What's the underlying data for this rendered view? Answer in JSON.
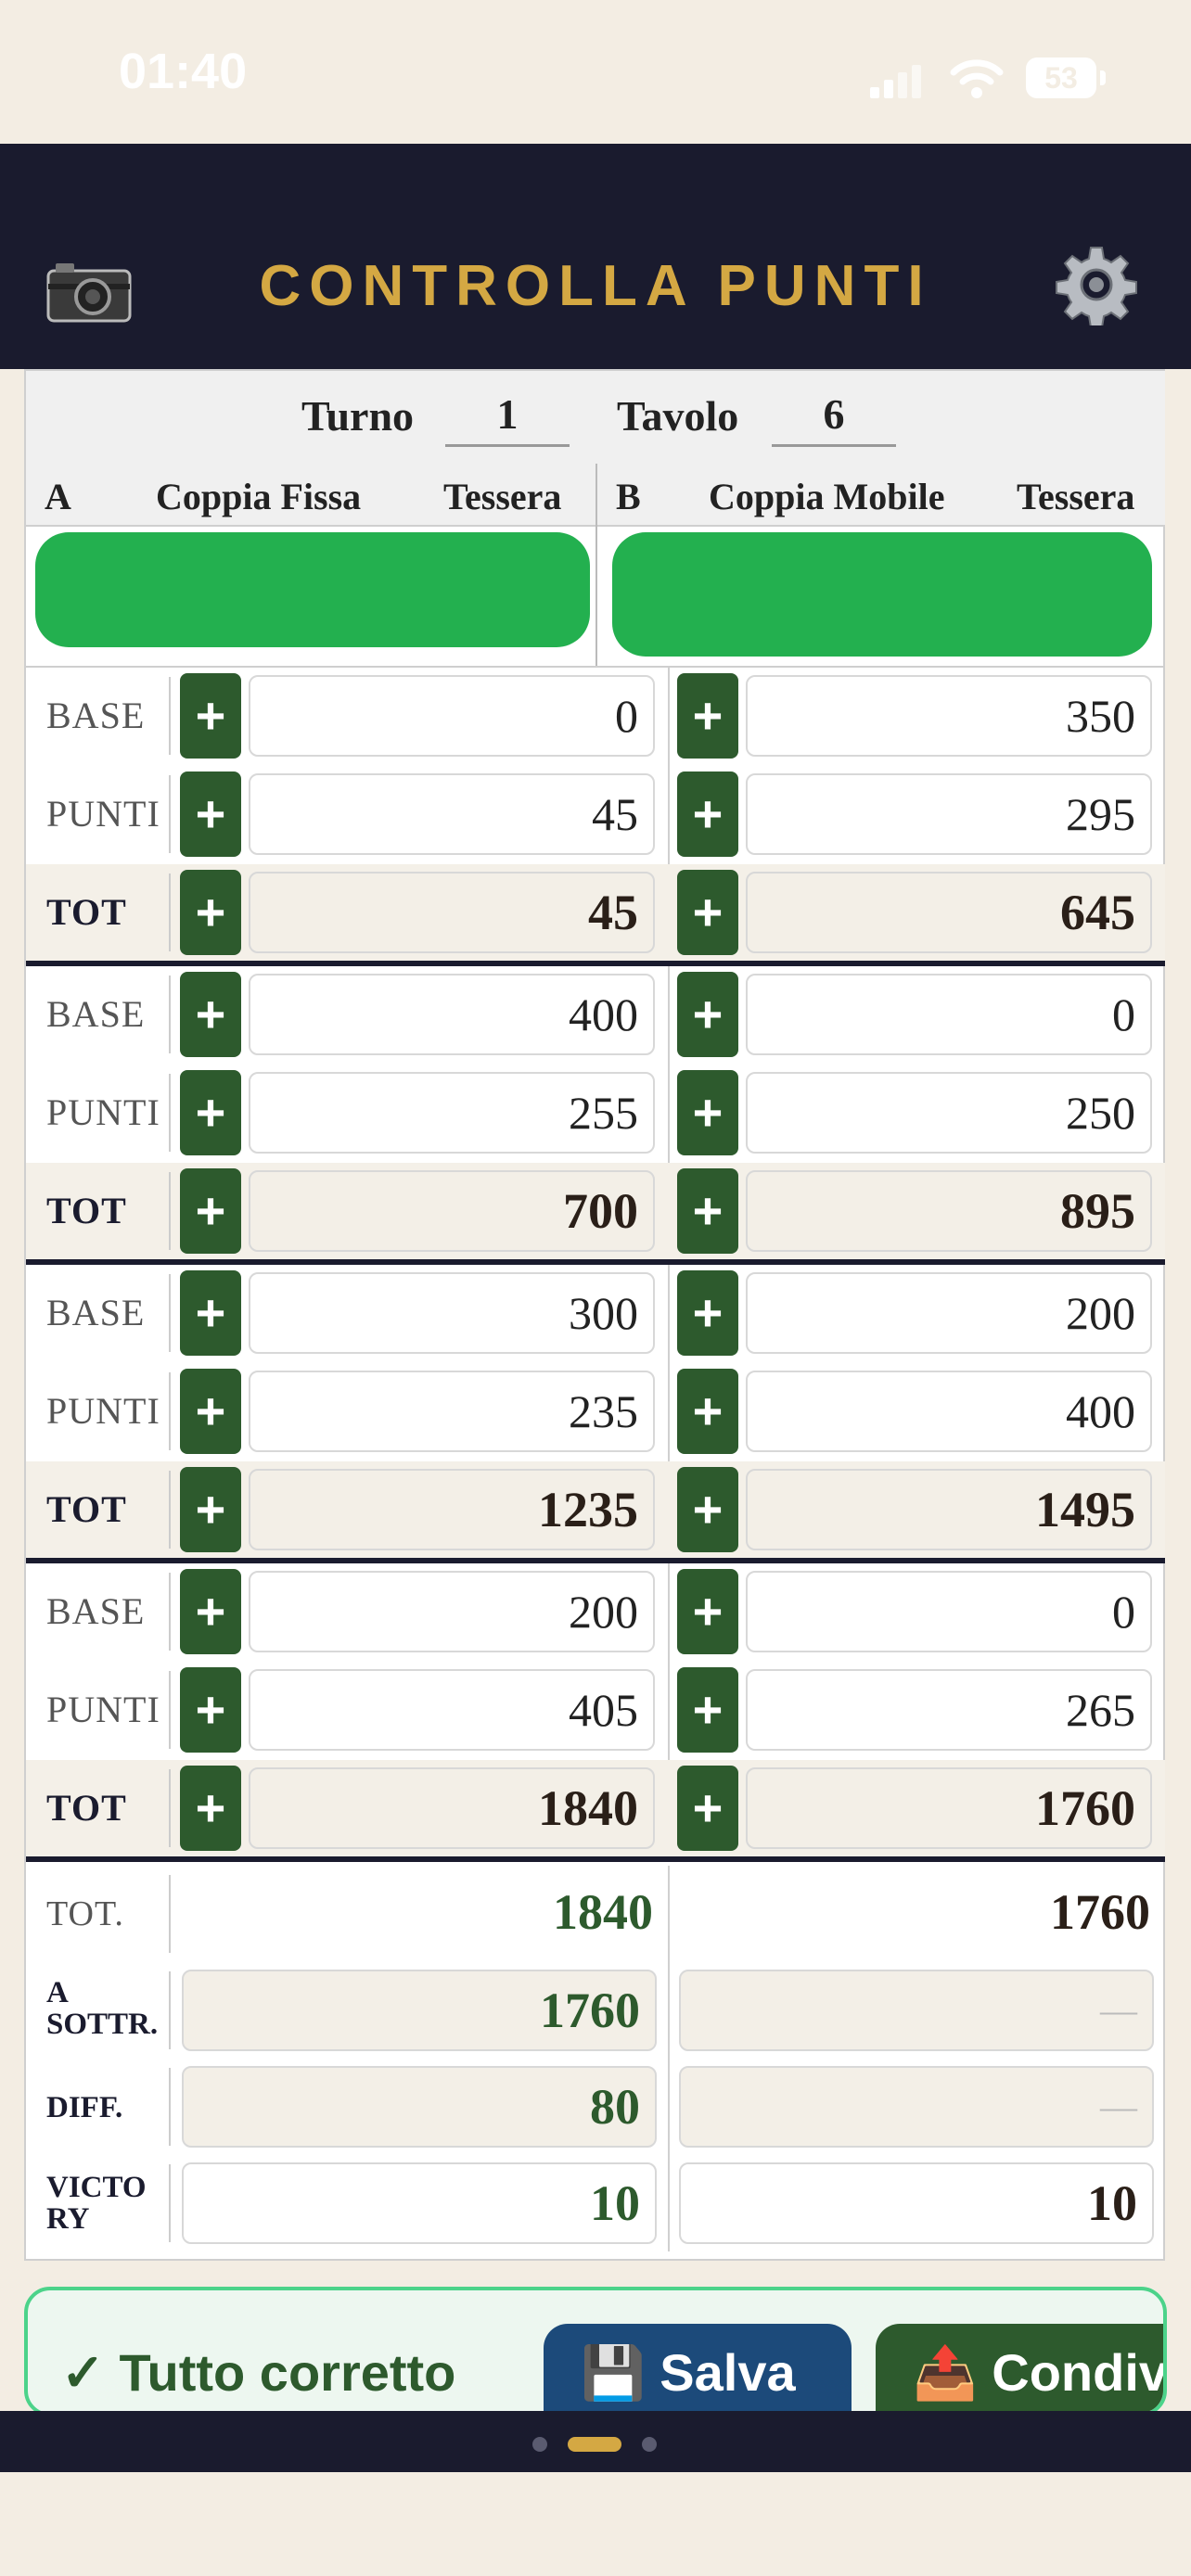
{
  "status": {
    "time": "01:40",
    "battery": "53"
  },
  "header": {
    "title": "CONTROLLA PUNTI",
    "camera_icon": "camera-icon",
    "settings_icon": "gear-icon"
  },
  "round": {
    "turno_label": "Turno",
    "turno_value": "1",
    "tavolo_label": "Tavolo",
    "tavolo_value": "6"
  },
  "columns": {
    "a_letter": "A",
    "a_title": "Coppia Fissa",
    "a_card": "Tessera",
    "b_letter": "B",
    "b_title": "Coppia Mobile",
    "b_card": "Tessera"
  },
  "labels": {
    "base": "BASE",
    "punti": "PUNTI",
    "tot": "TOT",
    "plus": "+"
  },
  "rounds": [
    {
      "a": {
        "base": "0",
        "punti": "45",
        "tot": "45"
      },
      "b": {
        "base": "350",
        "punti": "295",
        "tot": "645"
      }
    },
    {
      "a": {
        "base": "400",
        "punti": "255",
        "tot": "700"
      },
      "b": {
        "base": "0",
        "punti": "250",
        "tot": "895"
      }
    },
    {
      "a": {
        "base": "300",
        "punti": "235",
        "tot": "1235"
      },
      "b": {
        "base": "200",
        "punti": "400",
        "tot": "1495"
      }
    },
    {
      "a": {
        "base": "200",
        "punti": "405",
        "tot": "1840"
      },
      "b": {
        "base": "0",
        "punti": "265",
        "tot": "1760"
      }
    }
  ],
  "summary": {
    "tot_label": "TOT.",
    "tot_a": "1840",
    "tot_b": "1760",
    "sottr_label_1": "A",
    "sottr_label_2": "SOTTR.",
    "sottr_a": "1760",
    "sottr_b": "—",
    "diff_label": "DIFF.",
    "diff_a": "80",
    "diff_b": "—",
    "victory_label_1": "VICTO",
    "victory_label_2": "RY",
    "victory_a": "10",
    "victory_b": "10"
  },
  "footer": {
    "status": "✓ Tutto corretto",
    "save": "💾 Salva",
    "share": "📤 Condivi"
  },
  "colors": {
    "navy": "#1a1b2e",
    "gold": "#d4a843",
    "green": "#2d5a2d"
  }
}
